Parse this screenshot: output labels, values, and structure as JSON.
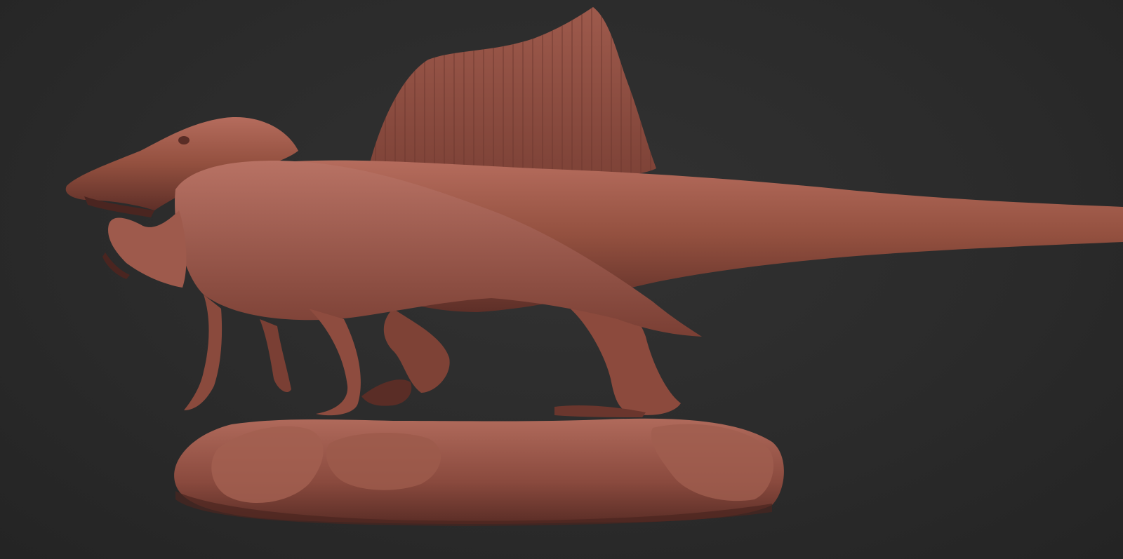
{
  "scene": {
    "subject": "sculpt-render",
    "colors": {
      "background": "#2a2a2a",
      "clay_base": "#8a4b40",
      "clay_light": "#b0685a",
      "clay_dark": "#5a2e27",
      "clay_shadow": "#3d1f1b"
    }
  }
}
